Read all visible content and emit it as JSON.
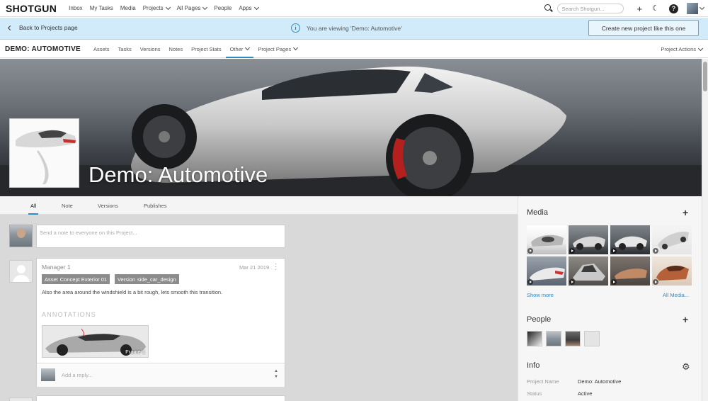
{
  "topnav": {
    "logo": "SHOTGUN",
    "links": [
      "Inbox",
      "My Tasks",
      "Media",
      "Projects",
      "All Pages",
      "People",
      "Apps"
    ],
    "search_placeholder": "Search Shotgun..."
  },
  "infobar": {
    "back_label": "Back to Projects page",
    "viewing_text": "You are viewing 'Demo: Automotive'",
    "new_project_label": "Create new project like this one"
  },
  "projnav": {
    "project_name": "DEMO: AUTOMOTIVE",
    "tabs": [
      "Assets",
      "Tasks",
      "Versions",
      "Notes",
      "Project Stats",
      "Other",
      "Project Pages"
    ],
    "actions_label": "Project Actions"
  },
  "hero": {
    "title": "Demo: Automotive"
  },
  "feed": {
    "tabs": [
      "All",
      "Note",
      "Versions",
      "Publishes"
    ],
    "composer_placeholder": "Send a note to everyone on this Project...",
    "note": {
      "author": "Manager 1",
      "date": "Mar 21 2019",
      "tag1_prefix": "Asset",
      "tag1_value": "Concept Exterior 01",
      "tag2_prefix": "Version",
      "tag2_value": "side_car_design",
      "body": "Also the area around the windshield is a bit rough, lets smooth this transition.",
      "annotations_heading": "ANNOTATIONS",
      "frame_label": "Frame 1",
      "reply_placeholder": "Add a reply..."
    }
  },
  "sidebar": {
    "media_heading": "Media",
    "show_more": "Show more",
    "all_media": "All Media...",
    "people_heading": "People",
    "info_heading": "Info",
    "info_rows": [
      {
        "label": "Project Name",
        "value": "Demo: Automotive"
      },
      {
        "label": "Status",
        "value": "Active"
      }
    ]
  },
  "colors": {
    "accent": "#2a8dc8",
    "infobar_bg": "#d1ebfa"
  }
}
